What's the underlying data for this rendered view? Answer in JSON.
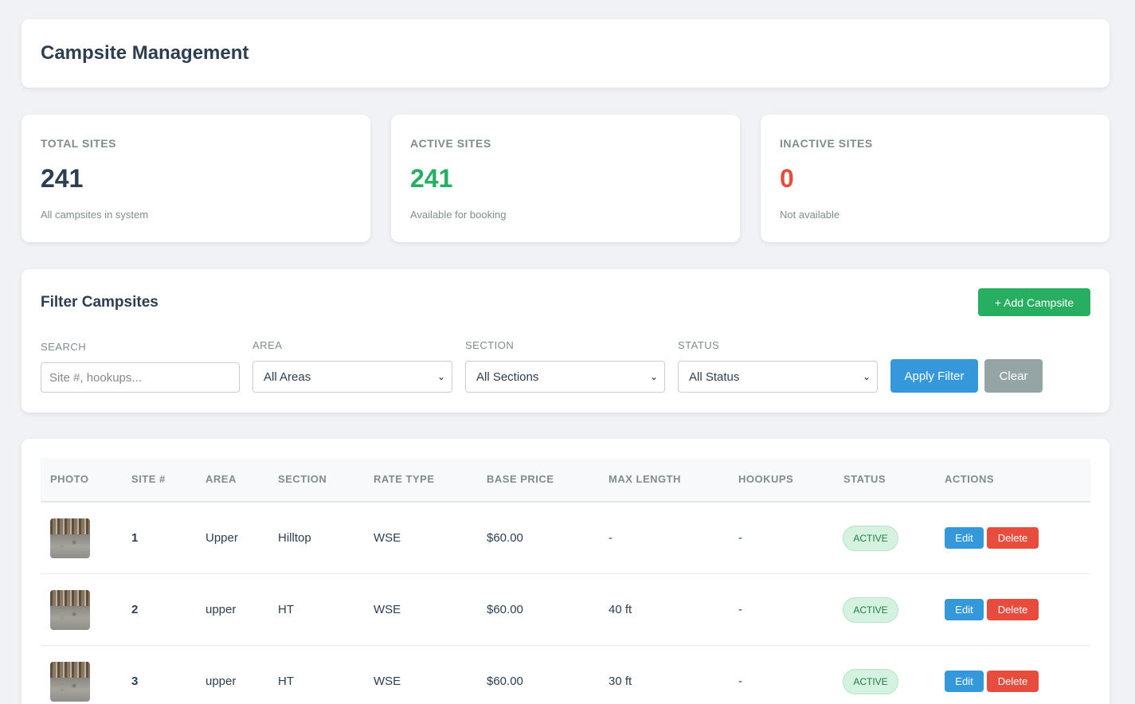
{
  "header": {
    "title": "Campsite Management"
  },
  "stats": [
    {
      "label": "TOTAL SITES",
      "value": "241",
      "sub": "All campsites in system",
      "color": "#2c3e50"
    },
    {
      "label": "ACTIVE SITES",
      "value": "241",
      "sub": "Available for booking",
      "color": "#27ae60"
    },
    {
      "label": "INACTIVE SITES",
      "value": "0",
      "sub": "Not available",
      "color": "#e74c3c"
    }
  ],
  "filter": {
    "title": "Filter Campsites",
    "add_label": "+ Add Campsite",
    "search_label": "SEARCH",
    "search_placeholder": "Site #, hookups...",
    "area_label": "AREA",
    "area_value": "All Areas",
    "section_label": "SECTION",
    "section_value": "All Sections",
    "status_label": "STATUS",
    "status_value": "All Status",
    "apply_label": "Apply Filter",
    "clear_label": "Clear"
  },
  "table": {
    "columns": [
      "PHOTO",
      "SITE #",
      "AREA",
      "SECTION",
      "RATE TYPE",
      "BASE PRICE",
      "MAX LENGTH",
      "HOOKUPS",
      "STATUS",
      "ACTIONS"
    ],
    "rows": [
      {
        "site": "1",
        "area": "Upper",
        "section": "Hilltop",
        "rate": "WSE",
        "price": "$60.00",
        "length": "-",
        "hookups": "-",
        "status": "ACTIVE",
        "edit": "Edit",
        "delete": "Delete"
      },
      {
        "site": "2",
        "area": "upper",
        "section": "HT",
        "rate": "WSE",
        "price": "$60.00",
        "length": "40 ft",
        "hookups": "-",
        "status": "ACTIVE",
        "edit": "Edit",
        "delete": "Delete"
      },
      {
        "site": "3",
        "area": "upper",
        "section": "HT",
        "rate": "WSE",
        "price": "$60.00",
        "length": "30 ft",
        "hookups": "-",
        "status": "ACTIVE",
        "edit": "Edit",
        "delete": "Delete"
      }
    ]
  },
  "colors": {
    "primary": "#3498db",
    "success": "#27ae60",
    "danger": "#e74c3c",
    "muted": "#95a5a6"
  },
  "icons": {
    "select_arrow": "chevron-down-icon"
  }
}
